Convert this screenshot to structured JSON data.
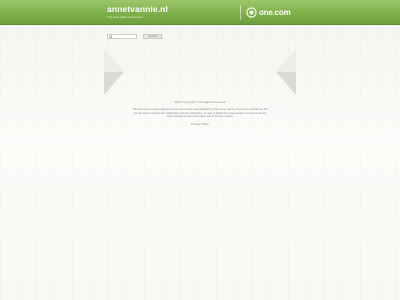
{
  "header": {
    "site_title": "annetvannie.nl",
    "tagline": "The web space is reserved",
    "brand_text": "one.com"
  },
  "search": {
    "button_label": "Search"
  },
  "footer": {
    "copyright": "2016 Copyright © All Rights Reserved",
    "disclaimer": "The Sponsored Listings displayed above are served automatically by a third party. Neither the service provider nor the domain owner maintain any relationship with the advertisers. In case of trademark issues please contact the domain owner directly (contact information can be found in whois).",
    "privacy_link": "Privacy Policy"
  },
  "colors": {
    "header_green": "#7fb04b",
    "background": "#fbfcf9"
  }
}
